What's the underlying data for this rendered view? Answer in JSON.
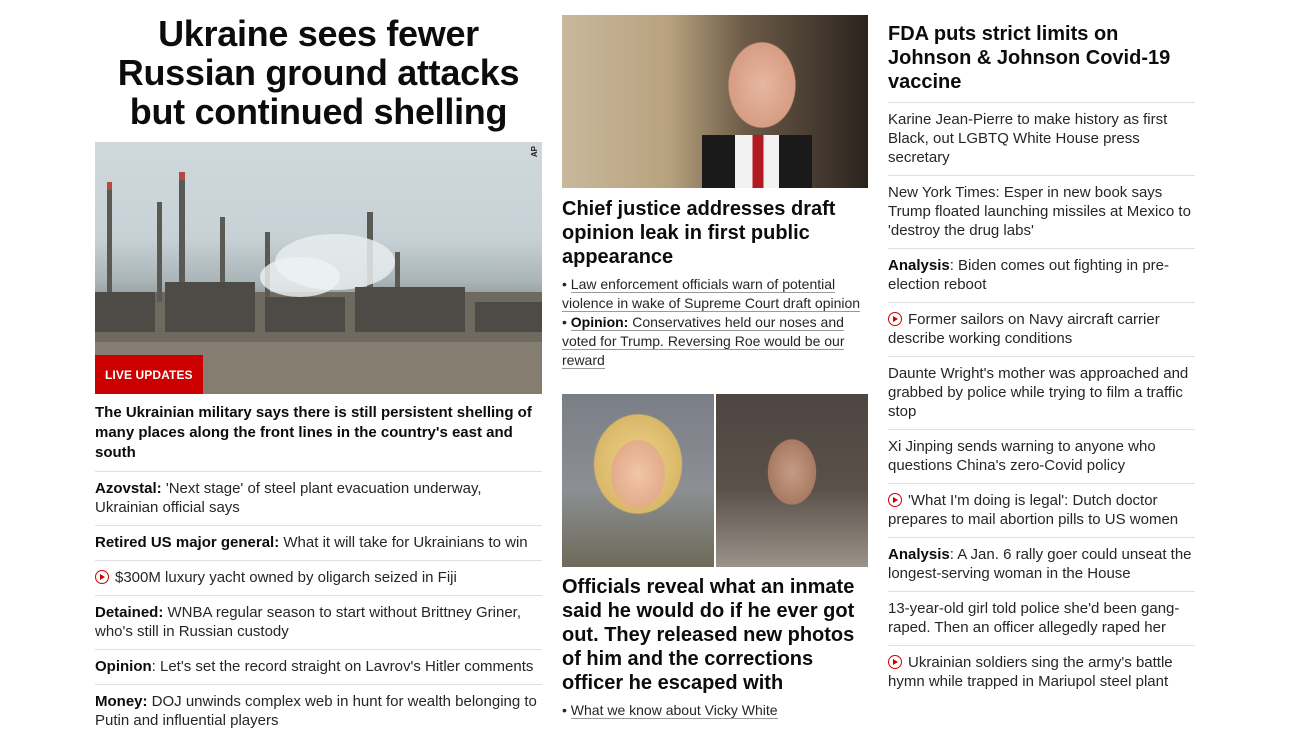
{
  "left": {
    "headline": "Ukraine sees fewer Russian ground attacks but continued shelling",
    "image_credit": "AP",
    "badge": "LIVE UPDATES",
    "summary": "The Ukrainian military says there is still persistent shelling of many places along the front lines in the country's east and south",
    "items": [
      {
        "prefix": "Azovstal:",
        "text": " 'Next stage' of steel plant evacuation underway, Ukrainian official says",
        "video": false
      },
      {
        "prefix": "Retired US major general:",
        "text": " What it will take for Ukrainians to win",
        "video": false
      },
      {
        "prefix": "",
        "text": "$300M luxury yacht owned by oligarch seized in Fiji",
        "video": true
      },
      {
        "prefix": "Detained:",
        "text": " WNBA regular season to start without Brittney Griner, who's still in Russian custody",
        "video": false
      },
      {
        "prefix": "Opinion",
        "text": ": Let's set the record straight on Lavrov's Hitler comments",
        "video": false
      },
      {
        "prefix": "Money:",
        "text": " DOJ unwinds complex web in hunt for wealth belonging to Putin and influential players",
        "video": false
      }
    ]
  },
  "middle": {
    "story1": {
      "title": "Chief justice addresses draft opinion leak in first public appearance",
      "links": [
        {
          "bullet": "• ",
          "prefix": "",
          "text": "Law enforcement officials warn of potential violence in wake of Supreme Court draft opinion"
        },
        {
          "bullet": "• ",
          "prefix": "Opinion:",
          "text": " Conservatives held our noses and voted for Trump. Reversing Roe would be our reward"
        }
      ]
    },
    "story2": {
      "title": "Officials reveal what an inmate said he would do if he ever got out. They released new photos of him and the corrections officer he escaped with",
      "links": [
        {
          "bullet": "• ",
          "prefix": "",
          "text": "What we know about Vicky White"
        }
      ]
    }
  },
  "right": {
    "headline": "FDA puts strict limits on Johnson & Johnson Covid-19 vaccine",
    "items": [
      {
        "prefix": "",
        "text": "Karine Jean-Pierre to make history as first Black, out LGBTQ White House press secretary",
        "video": false
      },
      {
        "prefix": "",
        "text": "New York Times: Esper in new book says Trump floated launching missiles at Mexico to 'destroy the drug labs'",
        "video": false
      },
      {
        "prefix": "Analysis",
        "text": ": Biden comes out fighting in pre-election reboot",
        "video": false
      },
      {
        "prefix": "",
        "text": "Former sailors on Navy aircraft carrier describe working conditions",
        "video": true
      },
      {
        "prefix": "",
        "text": "Daunte Wright's mother was approached and grabbed by police while trying to film a traffic stop",
        "video": false
      },
      {
        "prefix": "",
        "text": "Xi Jinping sends warning to anyone who questions China's zero-Covid policy",
        "video": false
      },
      {
        "prefix": "",
        "text": "'What I'm doing is legal': Dutch doctor prepares to mail abortion pills to US women",
        "video": true
      },
      {
        "prefix": "Analysis",
        "text": ": A Jan. 6 rally goer could unseat the longest-serving woman in the House",
        "video": false
      },
      {
        "prefix": "",
        "text": "13-year-old girl told police she'd been gang-raped. Then an officer allegedly raped her",
        "video": false
      },
      {
        "prefix": "",
        "text": "Ukrainian soldiers sing the army's battle hymn while trapped in Mariupol steel plant",
        "video": true
      }
    ]
  },
  "colors": {
    "accent": "#cc0000",
    "text": "#0c0c0c",
    "divider": "#e0e0e0"
  },
  "icons": {
    "video": "play-circle-icon"
  }
}
